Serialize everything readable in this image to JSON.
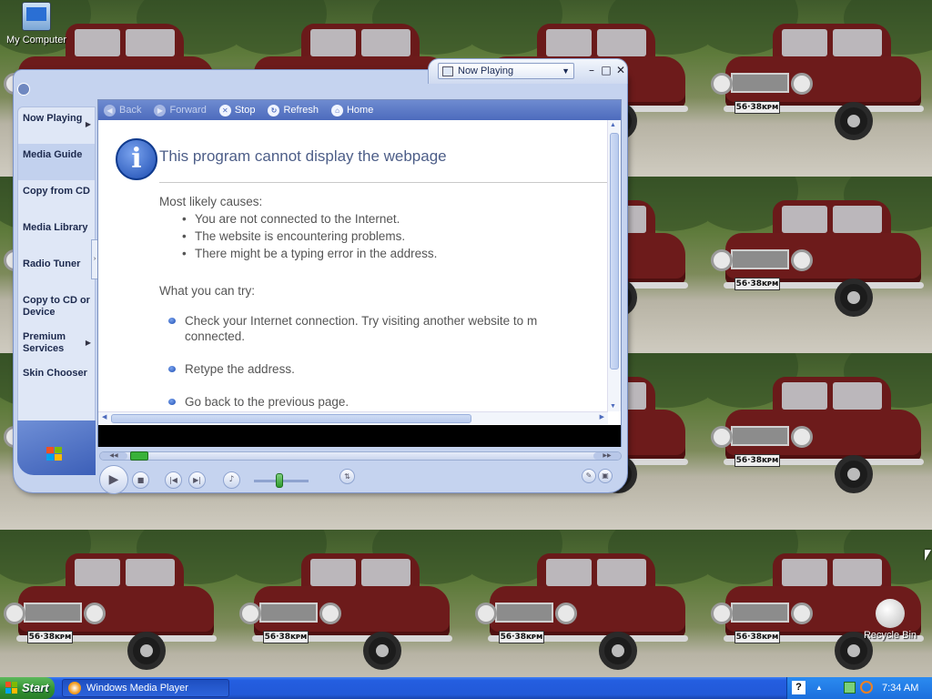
{
  "desktop": {
    "icons": [
      {
        "label": "My Computer"
      },
      {
        "label": "Recycle Bin"
      }
    ],
    "wallpaper_plate": "56·38ᴋᴘᴍ"
  },
  "wmp": {
    "now_playing_dropdown": "Now Playing",
    "window_buttons": {
      "minimize": "–",
      "maximize": "□",
      "close": "✕"
    },
    "nav_items": [
      {
        "label": "Now Playing",
        "has_arrow": true
      },
      {
        "label": "Media Guide",
        "has_arrow": false,
        "active": true
      },
      {
        "label": "Copy from CD",
        "has_arrow": false
      },
      {
        "label": "Media Library",
        "has_arrow": false
      },
      {
        "label": "Radio Tuner",
        "has_arrow": false
      },
      {
        "label": "Copy to CD or Device",
        "has_arrow": false
      },
      {
        "label": "Premium Services",
        "has_arrow": true
      },
      {
        "label": "Skin Chooser",
        "has_arrow": false
      }
    ],
    "browser_toolbar": {
      "back": "Back",
      "forward": "Forward",
      "stop": "Stop",
      "refresh": "Refresh",
      "home": "Home"
    },
    "error_page": {
      "title": "This program cannot display the webpage",
      "causes_heading": "Most likely causes:",
      "causes": [
        "You are not connected to the Internet.",
        "The website is encountering problems.",
        "There might be a typing error in the address."
      ],
      "try_heading": "What you can try:",
      "try_items": [
        "Check your Internet connection. Try visiting another website to m\nconnected.",
        "Retype the address.",
        "Go back to the previous page."
      ]
    },
    "colors": {
      "frame": "#c5d3ef",
      "toolbar": "#4d6bbd",
      "seek_knob": "#39b139"
    }
  },
  "taskbar": {
    "start_label": "Start",
    "task_label": "Windows Media Player",
    "clock": "7:34 AM",
    "help_icon_text": "?"
  }
}
